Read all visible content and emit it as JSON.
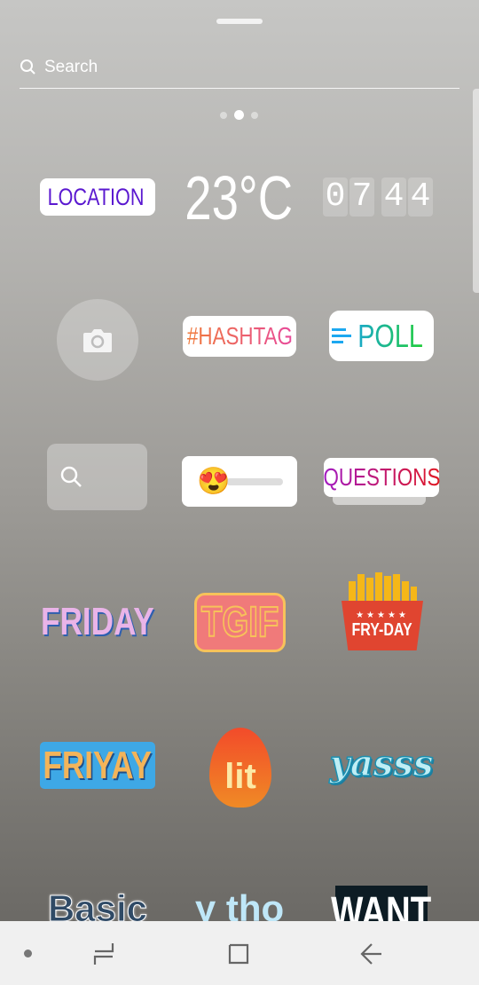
{
  "search": {
    "placeholder": "Search"
  },
  "pager": {
    "pages": 3,
    "active": 1
  },
  "stickers": {
    "location": "LOCATION",
    "temperature": "23°C",
    "time": [
      "0",
      "7",
      "4",
      "4"
    ],
    "hashtag": "#HASHTAG",
    "poll": "POLL",
    "questions": "QUESTIONS",
    "emoji_slider": "😍",
    "friday": "FRIDAY",
    "tgif": "TGIF",
    "fry_day": "FRY-DAY",
    "friyay": "FRIYAY",
    "lit": "lit",
    "yasss": "yasss",
    "basic": "Basic",
    "y_tho": "y tho",
    "want": "WANT"
  },
  "colors": {
    "location": "#7b1fd0",
    "poll": "#1cc24e",
    "questions": "#c0148a",
    "tgif": "#f07a7a",
    "friyay": "#3ea8e6",
    "fries": "#e04530"
  },
  "nav": {
    "icons": [
      "dot-icon",
      "recents-icon",
      "home-icon",
      "back-icon"
    ]
  }
}
